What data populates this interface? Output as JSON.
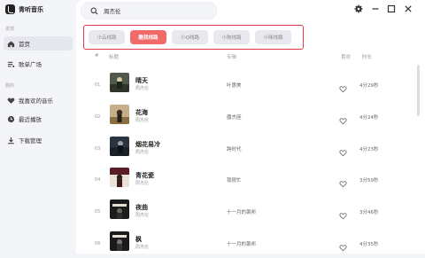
{
  "app": {
    "name": "青听音乐"
  },
  "sidebar": {
    "section_discover": "发现",
    "section_mine": "我的",
    "items": [
      {
        "label": "首页",
        "icon": "home-icon"
      },
      {
        "label": "歌单广场",
        "icon": "playlist-icon"
      },
      {
        "label": "我喜欢的音乐",
        "icon": "heart-icon"
      },
      {
        "label": "最近播放",
        "icon": "clock-icon"
      },
      {
        "label": "下载管理",
        "icon": "download-icon"
      }
    ]
  },
  "search": {
    "value": "周杰伦"
  },
  "source_tabs": [
    {
      "label": "小云线路"
    },
    {
      "label": "酷我线路",
      "active": true
    },
    {
      "label": "小Q线路"
    },
    {
      "label": "小狗线路"
    },
    {
      "label": "小咪线路"
    }
  ],
  "table": {
    "headers": {
      "index": "#",
      "title": "标题",
      "album": "专辑",
      "like": "喜欢",
      "duration": "时长"
    },
    "rows": [
      {
        "index": "01",
        "title": "晴天",
        "artist": "周杰伦",
        "album": "叶惠美",
        "duration": "4分29秒"
      },
      {
        "index": "02",
        "title": "花海",
        "artist": "周杰伦",
        "album": "魔杰座",
        "duration": "4分24秒"
      },
      {
        "index": "03",
        "title": "烟花易冷",
        "artist": "周杰伦",
        "album": "跨时代",
        "duration": "4分23秒"
      },
      {
        "index": "04",
        "title": "青花瓷",
        "artist": "周杰伦",
        "album": "我很忙",
        "duration": "3分59秒"
      },
      {
        "index": "05",
        "title": "夜曲",
        "artist": "周杰伦",
        "album": "十一月的萧邦",
        "duration": "3分46秒"
      },
      {
        "index": "06",
        "title": "枫",
        "artist": "周杰伦",
        "album": "十一月的萧邦",
        "duration": "4分35秒"
      }
    ]
  }
}
